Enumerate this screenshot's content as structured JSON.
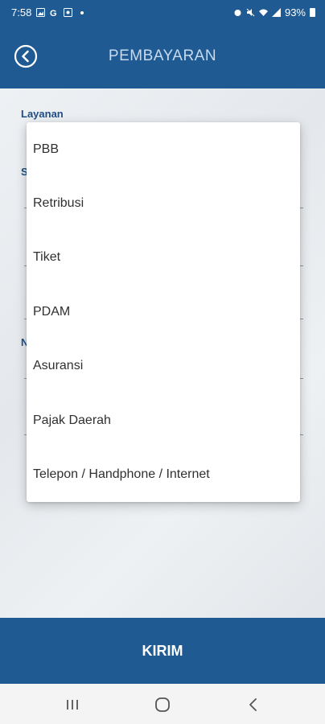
{
  "status_bar": {
    "time": "7:58",
    "battery": "93%"
  },
  "header": {
    "title": "PEMBAYARAN"
  },
  "form": {
    "layanan_label": "Layanan",
    "partial_label_1": "S",
    "partial_label_2": "N"
  },
  "dropdown": {
    "items": [
      "PBB",
      "Retribusi",
      "Tiket",
      "PDAM",
      "Asuransi",
      "Pajak Daerah",
      "Telepon / Handphone / Internet"
    ]
  },
  "submit": {
    "label": "KIRIM"
  },
  "colors": {
    "primary": "#1f5a92",
    "label": "#1f4e86"
  }
}
